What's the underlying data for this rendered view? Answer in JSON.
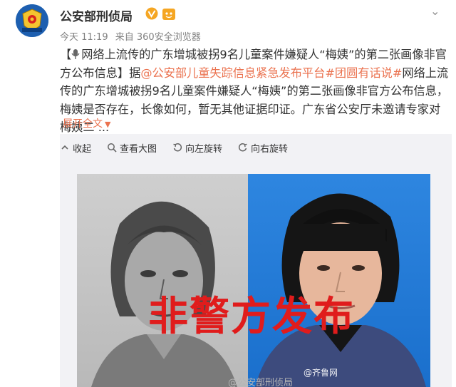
{
  "author": {
    "name": "公安部刑侦局",
    "avatar_badge": "公安部刑侦局"
  },
  "meta": {
    "time": "今天 11:19",
    "source": "来自 360安全浏览器"
  },
  "post": {
    "intro": "【",
    "headline": "网络上流传的广东增城被拐9名儿童案件嫌疑人“梅姨”的第二张画像非官方公布信息】",
    "according": "据",
    "mention": "@公安部儿童失踪信息紧急发布平台",
    "hashtag1": "#团圆有话说#",
    "body": "网络上流传的广东增城被拐9名儿童案件嫌疑人“梅姨”的第二张画像非官方公布信息，梅姨是否存在，长像如何，暂无其他证据印证。广东省公安厅未邀请专家对梅姨二 ...",
    "expand_label": "展开全文",
    "expand_icon": "chevron-down"
  },
  "toolbar": {
    "collapse": "收起",
    "view_large": "查看大图",
    "rotate_left": "向左旋转",
    "rotate_right": "向右旋转"
  },
  "image": {
    "stamp_text": "非警方发布",
    "source_watermark": "@齐鲁网",
    "author_watermark": "@公安部刑侦局"
  },
  "colors": {
    "link": "#eb7350",
    "stamp": "#e01c1c",
    "verified": "#f5a623"
  }
}
